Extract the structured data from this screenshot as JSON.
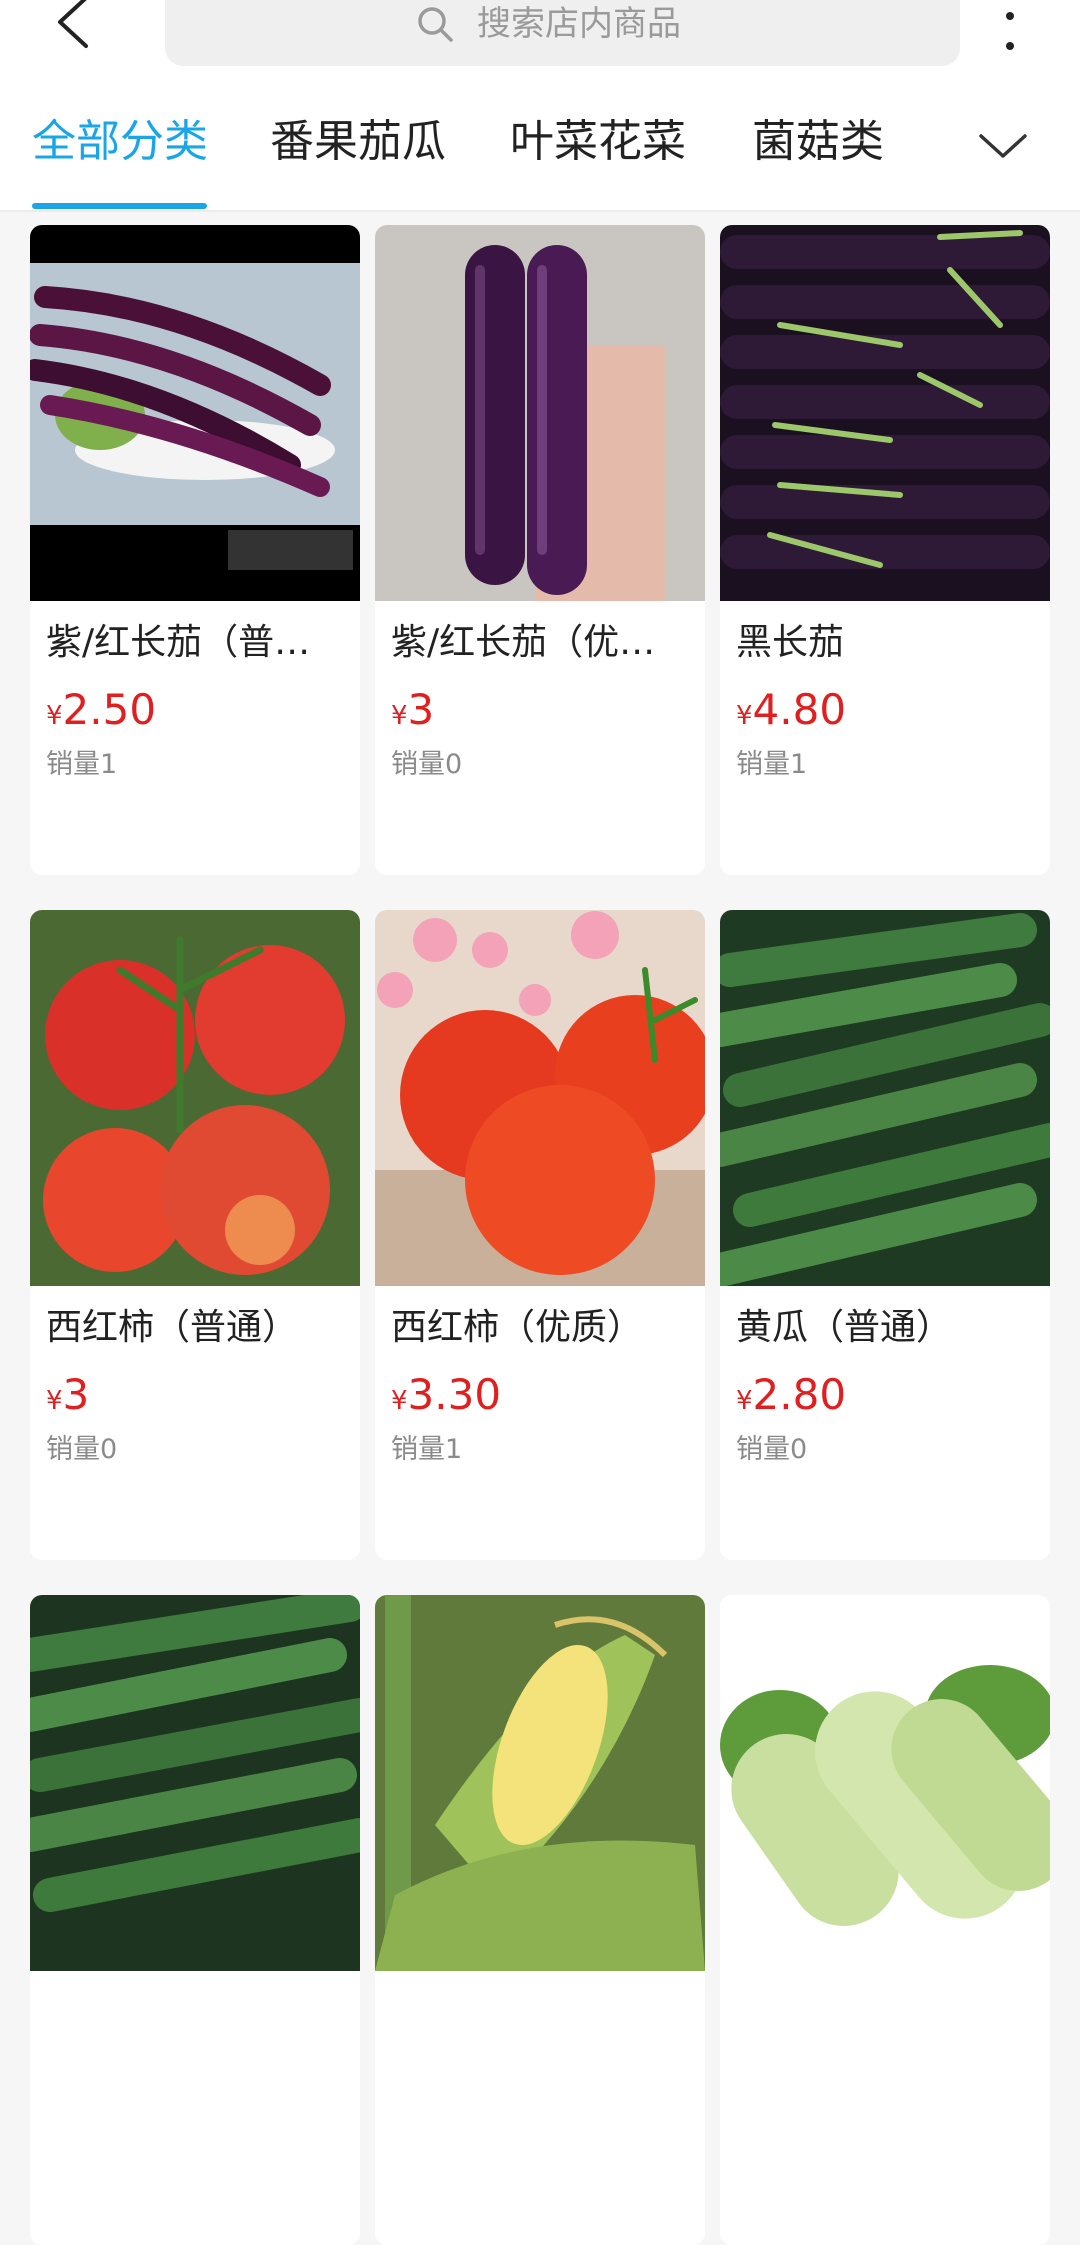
{
  "header": {
    "search_placeholder": "搜索店内商品"
  },
  "tabs": [
    {
      "label": "全部分类"
    },
    {
      "label": "番果茄瓜"
    },
    {
      "label": "叶菜花菜"
    },
    {
      "label": "菌菇类"
    }
  ],
  "currency": "¥",
  "products": [
    {
      "title": "紫/红长茄（普通）",
      "price": "2.50",
      "sales": "销量1",
      "image": "purple-red-long-eggplant-photo"
    },
    {
      "title": "紫/红长茄（优质）",
      "price": "3",
      "sales": "销量0",
      "image": "purple-eggplant-hand-photo"
    },
    {
      "title": "黑长茄",
      "price": "4.80",
      "sales": "销量1",
      "image": "black-long-eggplant-photo"
    },
    {
      "title": "西红柿（普通）",
      "price": "3",
      "sales": "销量0",
      "image": "tomato-vine-photo"
    },
    {
      "title": "西红柿（优质）",
      "price": "3.30",
      "sales": "销量1",
      "image": "tomato-flowers-photo"
    },
    {
      "title": "黄瓜（普通）",
      "price": "2.80",
      "sales": "销量0",
      "image": "cucumber-photo"
    },
    {
      "title": "",
      "price": "",
      "sales": "",
      "image": "cucumber-photo-2"
    },
    {
      "title": "",
      "price": "",
      "sales": "",
      "image": "corn-photo"
    },
    {
      "title": "",
      "price": "",
      "sales": "",
      "image": "zucchini-photo"
    }
  ],
  "colors": {
    "accent": "#1aa5e6",
    "price": "#e02020"
  }
}
